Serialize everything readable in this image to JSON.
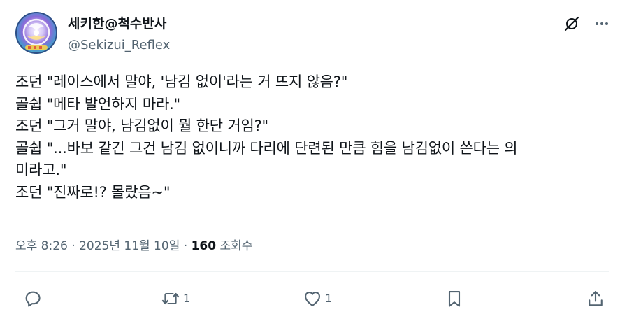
{
  "author": {
    "display_name": "세키한@척수반사",
    "handle": "@Sekizui_Reflex"
  },
  "body_lines": [
    "조던 \"레이스에서 말야, '남김 없이'라는 거 뜨지 않음?\"",
    "골쉽 \"메타 발언하지 마라.\"",
    "조던 \"그거 말야, 남김없이 뭘 한단 거임?\"",
    "골쉽 \"...바보 같긴 그건 남김 없이니까 다리에 단련된 만큼 힘을 남김없이 쓴다는 의",
    "미라고.\"",
    "조던 \"진짜로!? 몰랐음~\""
  ],
  "meta": {
    "time": "오후 8:26",
    "separator1": " · ",
    "date": "2025년 11월 10일",
    "separator2": " · ",
    "views_count": "160",
    "views_label": " 조회수"
  },
  "actions": {
    "reply": {
      "icon": "reply-icon",
      "count": ""
    },
    "retweet": {
      "icon": "retweet-icon",
      "count": "1"
    },
    "like": {
      "icon": "heart-icon",
      "count": "1"
    },
    "bookmark": {
      "icon": "bookmark-icon",
      "count": ""
    },
    "share": {
      "icon": "share-icon",
      "count": ""
    }
  },
  "colors": {
    "text_primary": "#0f1419",
    "text_secondary": "#536471",
    "divider": "#eff3f4",
    "background": "#ffffff"
  }
}
